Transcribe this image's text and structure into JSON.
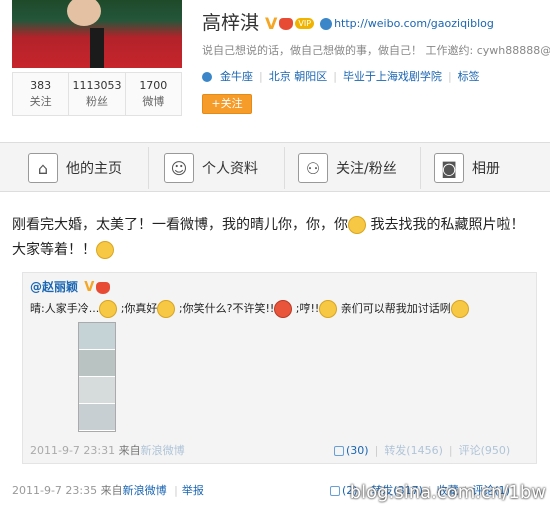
{
  "profile": {
    "name": "高梓淇",
    "verified_badge": "V",
    "vip_badge": "VIP",
    "url": "http://weibo.com/gaoziqiblog",
    "bio": "说自己想说的话，做自己想做的事，做自己！ 工作邀约: cywh88888@",
    "constellation": "金牛座",
    "location": "北京 朝阳区",
    "school": "毕业于上海戏剧学院",
    "tags_label": "标签",
    "follow_label": "+关注",
    "stats": [
      {
        "num": "383",
        "label": "关注"
      },
      {
        "num": "1113053",
        "label": "粉丝"
      },
      {
        "num": "1700",
        "label": "微博"
      }
    ]
  },
  "nav": {
    "tabs": [
      {
        "label": "他的主页",
        "icon": "home-icon"
      },
      {
        "label": "个人资料",
        "icon": "person-icon"
      },
      {
        "label": "关注/粉丝",
        "icon": "people-icon"
      },
      {
        "label": "相册",
        "icon": "camera-icon"
      }
    ]
  },
  "post": {
    "text1": "刚看完大婚，太美了！一看微博，我的晴儿你，你，你",
    "text2": " 我去找我的私藏照片啦！大家等着！！",
    "date": "2011-9-7 23:35",
    "from_label": "来自",
    "source": "新浪微博",
    "report": "举报",
    "actions": {
      "like": "(2)",
      "repost": "转发(317)",
      "favorite": "收藏",
      "comment": "评论(1)"
    }
  },
  "quote": {
    "author": "@赵丽颖",
    "author_badge": "V",
    "parts": [
      "晴:人家手冷...",
      " ;你真好",
      " ;你笑什么?不许笑!!",
      " ;哼!!",
      " 亲们可以帮我加讨话咧"
    ],
    "date": "2011-9-7 23:31",
    "from_label": "来自",
    "source": "新浪微博",
    "actions": {
      "like": "(30)",
      "repost": "转发(1456)",
      "comment": "评论(950)"
    }
  },
  "watermark": "blog.sina.com.cn/1bw"
}
